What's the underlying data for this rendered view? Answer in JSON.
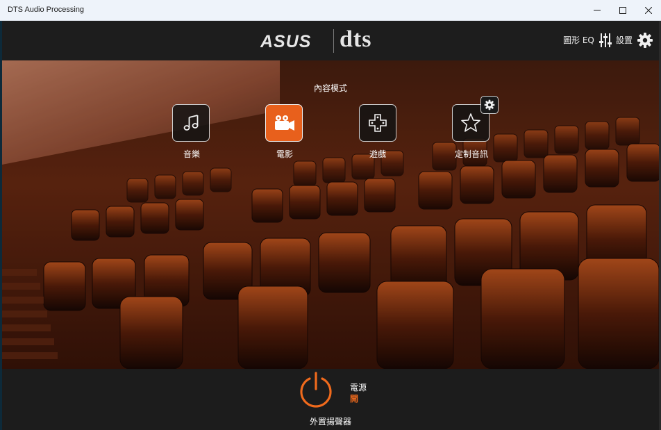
{
  "window": {
    "title": "DTS Audio Processing"
  },
  "header": {
    "brand_asus": "ASUS",
    "brand_dts": "dts",
    "eq_label": "圖形 EQ",
    "settings_label": "設置",
    "eq_icon": "sliders-icon",
    "settings_icon": "gear-icon"
  },
  "content_mode": {
    "title": "內容模式",
    "modes": [
      {
        "label": "音樂",
        "icon": "music-note-icon",
        "active": false
      },
      {
        "label": "電影",
        "icon": "movie-camera-icon",
        "active": true
      },
      {
        "label": "遊戲",
        "icon": "gamepad-icon",
        "active": false
      },
      {
        "label": "定制音訊",
        "icon": "star-icon",
        "active": false
      }
    ]
  },
  "power": {
    "label": "電源",
    "state": "開",
    "device": "外置揚聲器"
  },
  "colors": {
    "accent": "#e8601c",
    "header_bg": "#1d1d1d",
    "titlebar_bg": "#eef3fa"
  }
}
